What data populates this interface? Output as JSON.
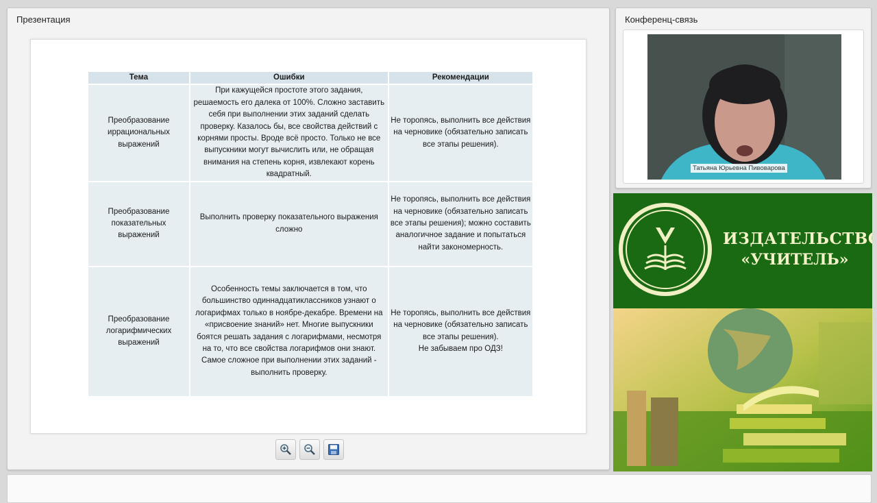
{
  "presentation": {
    "title": "Презентация",
    "table": {
      "headers": [
        "Тема",
        "Ошибки",
        "Рекомендации"
      ],
      "rows": [
        {
          "topic": "Преобразование иррациональных выражений",
          "errors": "При кажущейся простоте этого задания, решаемость его далека от 100%. Сложно заставить себя при выполнении этих заданий сделать проверку. Казалось бы, все свойства действий с корнями просты. Вроде всё просто. Только не все выпускники могут вычислить или, не обращая внимания на степень корня, извлекают корень квадратный.",
          "recommendation": "Не торопясь, выполнить все действия на черновике (обязательно записать все этапы решения)."
        },
        {
          "topic": "Преобразование показательных выражений",
          "errors": "Выполнить проверку показательного выражения сложно",
          "recommendation": "Не торопясь, выполнить все действия на черновике (обязательно записать все этапы решения); можно составить аналогичное задание и попытаться найти закономерность."
        },
        {
          "topic": "Преобразование логарифмических выражений",
          "errors": "Особенность темы заключается в том, что большинство одиннадцатиклассников узнают о логарифмах только в ноябре-декабре. Времени на «присвоение знаний» нет. Многие выпускники боятся решать задания с логарифмами, несмотря на то, что все свойства логарифмов они знают. Самое сложное при выполнении этих заданий - выполнить проверку.",
          "recommendation": "Не торопясь, выполнить все действия на черновике (обязательно записать все этапы решения).",
          "recommendation_extra": "Не забываем про ОДЗ!"
        }
      ]
    },
    "toolbar": {
      "zoom_in_icon": "zoom-in-icon",
      "zoom_out_icon": "zoom-out-icon",
      "save_icon": "floppy-save-icon"
    }
  },
  "conference": {
    "title": "Конференц-связь",
    "participant_name": "Татьяна Юрьевна Пивоварова"
  },
  "banner": {
    "line1": "ИЗДАТЕЛЬСТВО",
    "line2": "«УЧИТЕЛЬ»"
  },
  "colors": {
    "banner_green": "#1a6a14",
    "banner_text": "#f3f2c9",
    "table_header": "#d6e3ea",
    "table_cell": "#e7eef2"
  }
}
